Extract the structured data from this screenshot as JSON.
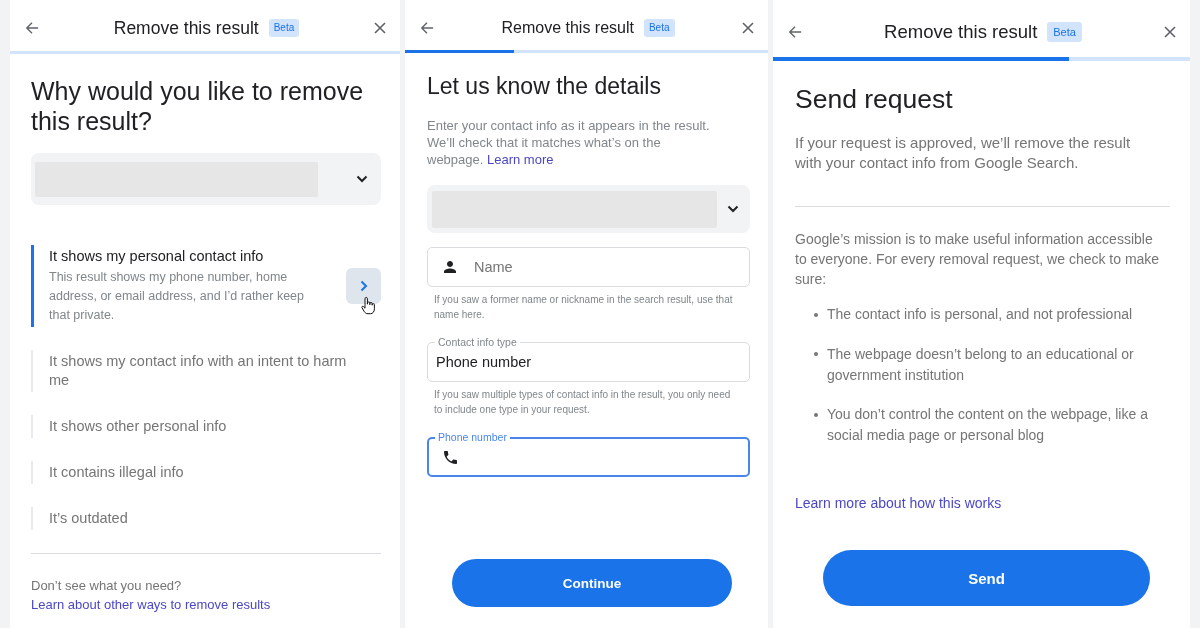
{
  "reason_panel": {
    "header": {
      "title": "Remove this result",
      "badge": "Beta"
    },
    "heading": "Why would you like to remove this result?",
    "dropdown": {
      "redacted": true
    },
    "options": [
      {
        "title": "It shows my personal contact info",
        "description": "This result shows my phone number, home address, or email address, and I’d rather keep that private.",
        "selected": true
      },
      {
        "title": "It shows my contact info with an intent to harm me",
        "selected": false
      },
      {
        "title": "It shows other personal info",
        "selected": false
      },
      {
        "title": "It contains illegal info",
        "selected": false
      },
      {
        "title": "It’s outdated",
        "selected": false
      }
    ],
    "footer": {
      "text": "Don’t see what you need?",
      "link": "Learn about other ways to remove results"
    }
  },
  "details_panel": {
    "header": {
      "title": "Remove this result",
      "badge": "Beta"
    },
    "progress": {
      "level": 0.3
    },
    "heading": "Let us know the details",
    "intro": {
      "text": "Enter your contact info as it appears in the result. We’ll check that it matches what’s on the webpage.",
      "link": "Learn more"
    },
    "dropdown": {
      "redacted": true
    },
    "name_field": {
      "placeholder": "Name",
      "helper": "If you saw a former name or nickname in the search result, use that name here."
    },
    "type_field": {
      "label": "Contact info type",
      "value": "Phone number",
      "helper": "If you saw multiple types of contact info in the result, you only need to include one type in your request."
    },
    "phone_field": {
      "label": "Phone number",
      "focused": true
    },
    "button": "Continue"
  },
  "send_panel": {
    "header": {
      "title": "Remove this result",
      "badge": "Beta"
    },
    "progress": {
      "level": 0.71
    },
    "heading": "Send request",
    "intro": "If your request is approved, we’ll remove the result with your contact info from Google Search.",
    "mission": "Google’s mission is to make useful information accessible to everyone. For every removal request, we check to make sure:",
    "checks": [
      "The contact info is personal, and not professional",
      "The webpage doesn’t belong to an educational or government institution",
      "You don’t control the content on the webpage, like a social media page or personal blog"
    ],
    "link": "Learn more about how this works",
    "button": "Send"
  }
}
